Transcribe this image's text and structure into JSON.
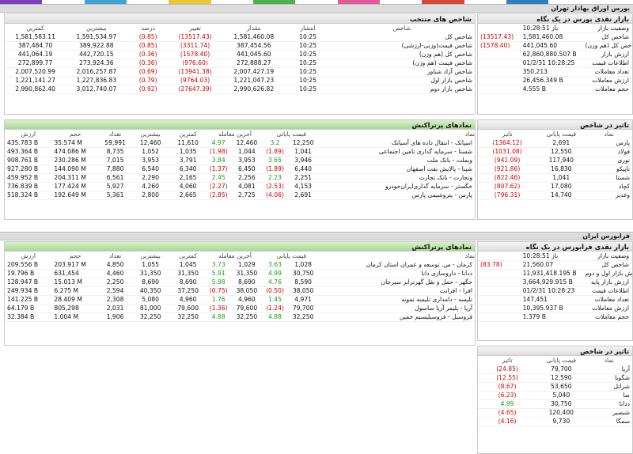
{
  "tse": {
    "title": "بورس اوراق بهادار تهران",
    "snapshot": {
      "title": "بازار نقدی بورس در یک نگاه",
      "rows": [
        {
          "label": "وضعیت بازار",
          "value": "باز 10:28:51",
          "extra": ""
        },
        {
          "label": "شاخص کل",
          "value": "1,581,460.08",
          "extra": "(13517.43)"
        },
        {
          "label": "شاخص کل (هم وزن)",
          "value": "441,045.60",
          "extra": "(1578.40)"
        },
        {
          "label": "ارزش بازار",
          "value": "62,860,880.507 B",
          "extra": ""
        },
        {
          "label": "اطلاعات قیمت",
          "value": "01/2/31 10:28:25",
          "extra": ""
        },
        {
          "label": "تعداد معاملات",
          "value": "350,213",
          "extra": ""
        },
        {
          "label": "ارزش معاملات",
          "value": "26,456.349 B",
          "extra": ""
        },
        {
          "label": "حجم معاملات",
          "value": "4.555 B",
          "extra": ""
        }
      ]
    },
    "indices": {
      "title": "شاخص های منتخب",
      "headers": [
        "شاخص",
        "انتشار",
        "مقدار",
        "تغییر",
        "درصد",
        "بیشترین",
        "کمترین"
      ],
      "rows": [
        {
          "name": "شاخص کل",
          "time": "10:25",
          "value": "1,581,460.08",
          "change": "(13517.43)",
          "pct": "(0.85)",
          "high": "1,591,534.97",
          "low": "1,581,583.11"
        },
        {
          "name": "شاخص قیمت(وزنی-ارزشی)",
          "time": "10:25",
          "value": "387,454.56",
          "change": "(3311.74)",
          "pct": "(0.85)",
          "high": "389,922.88",
          "low": "387,484.70"
        },
        {
          "name": "شاخص کل (هم وزن)",
          "time": "10:25",
          "value": "441,045.60",
          "change": "(1578.40)",
          "pct": "(0.36)",
          "high": "442,720.15",
          "low": "441,064.19"
        },
        {
          "name": "شاخص قیمت (هم وزن)",
          "time": "10:25",
          "value": "272,888.27",
          "change": "(976.60)",
          "pct": "(0.36)",
          "high": "273,924.36",
          "low": "272,899.77"
        },
        {
          "name": "شاخص آزاد شناور",
          "time": "10:25",
          "value": "2,007,427.19",
          "change": "(13941.38)",
          "pct": "(0.69)",
          "high": "2,016,257.87",
          "low": "2,007,520.99"
        },
        {
          "name": "شاخص بازار اول",
          "time": "10:25",
          "value": "1,221,047.23",
          "change": "(9764.03)",
          "pct": "(0.79)",
          "high": "1,227,836.83",
          "low": "1,221,141.27"
        },
        {
          "name": "شاخص بازار دوم",
          "time": "10:25",
          "value": "2,990,626.82",
          "change": "(27647.39)",
          "pct": "(0.92)",
          "high": "3,012,740.07",
          "low": "2,990,862.40"
        }
      ]
    },
    "impact": {
      "title": "تاثیر در شاخص",
      "headers": [
        "نماد",
        "قیمت پایانی",
        "تاثیر"
      ],
      "rows": [
        {
          "sym": "پارس",
          "price": "2,691",
          "effect": "(1364.12)"
        },
        {
          "sym": "فولاد",
          "price": "12,550",
          "effect": "(1031.08)"
        },
        {
          "sym": "نوری",
          "price": "117,940",
          "effect": "(941.09)"
        },
        {
          "sym": "تاپیکو",
          "price": "16,830",
          "effect": "(921.86)"
        },
        {
          "sym": "شستا",
          "price": "1,041",
          "effect": "(822.46)"
        },
        {
          "sym": "کچاد",
          "price": "17,080",
          "effect": "(807.62)"
        },
        {
          "sym": "وغدیر",
          "price": "14,740",
          "effect": "(796.31)"
        }
      ]
    },
    "top": {
      "title": "نمادهای پرتراکنش",
      "headers": [
        "نماد",
        "قیمت پایانی",
        "آخرین معامله",
        "کمترین",
        "بیشترین",
        "تعداد",
        "حجم",
        "ارزش"
      ],
      "rows": [
        {
          "name": "اسپانک - انتقال داده های آسیاتک",
          "close": "12,250",
          "close_chg": "3.2",
          "last": "12,460",
          "last_chg": "4.97",
          "low": "11,610",
          "high": "12,460",
          "count": "59,991",
          "vol": "35.574 M",
          "val": "435.783 B"
        },
        {
          "name": "شستا - سرمایه گذاری تامین اجتماعی",
          "close": "1,041",
          "close_chg": "(1.89)",
          "last": "1,044",
          "last_chg": "(1.98)",
          "low": "1,035",
          "high": "1,052",
          "count": "8,735",
          "vol": "474.086 M",
          "val": "493.364 B"
        },
        {
          "name": "وبملت - بانک ملت",
          "close": "3,946",
          "close_chg": "3.65",
          "last": "3,953",
          "last_chg": "3.84",
          "low": "3,791",
          "high": "3,953",
          "count": "7,015",
          "vol": "230.286 M",
          "val": "908.761 B"
        },
        {
          "name": "شپنا - پالایش نفت اصفهان",
          "close": "6,440",
          "close_chg": "(1.89)",
          "last": "6,450",
          "last_chg": "(1.37)",
          "low": "6,340",
          "high": "6,540",
          "count": "7,880",
          "vol": "144.090 M",
          "val": "927.280 B"
        },
        {
          "name": "وتجارت - بانک تجارت",
          "close": "2,251",
          "close_chg": "2.23",
          "last": "2,256",
          "last_chg": "2.45",
          "low": "2,165",
          "high": "2,290",
          "count": "6,561",
          "vol": "204.311 M",
          "val": "459.952 B"
        },
        {
          "name": "خگستر - سرمایه گذاری‌ایران‌خودرو",
          "close": "4,153",
          "close_chg": "(2.53)",
          "last": "4,081",
          "last_chg": "(2.27)",
          "low": "4,060",
          "high": "4,260",
          "count": "5,927",
          "vol": "177.424 M",
          "val": "736.839 B"
        },
        {
          "name": "پارس - پتروشیمی پارس",
          "close": "2,691",
          "close_chg": "(4.06)",
          "last": "2,725",
          "last_chg": "(2.85)",
          "low": "2,665",
          "high": "2,800",
          "count": "5,361",
          "vol": "192.649 M",
          "val": "518.324 B"
        }
      ]
    }
  },
  "ifb": {
    "title": "فرابورس ایران",
    "snapshot": {
      "title": "بازار نقدی فرابورس در یک نگاه",
      "rows": [
        {
          "label": "وضعیت بازار",
          "value": "باز 10:28:51",
          "extra": ""
        },
        {
          "label": "شاخص کل",
          "value": "21,560.07",
          "extra": "(83.78)"
        },
        {
          "label": "ارزش بازار اول و دوم",
          "value": "11,931,418.195 B",
          "extra": ""
        },
        {
          "label": "ارزش بازار پایه",
          "value": "3,664,929.915 B",
          "extra": ""
        },
        {
          "label": "اطلاعات قیمت",
          "value": "01/2/31 10:28:23",
          "extra": ""
        },
        {
          "label": "تعداد معاملات",
          "value": "147,451",
          "extra": ""
        },
        {
          "label": "ارزش معاملات",
          "value": "10,395.937 B",
          "extra": ""
        },
        {
          "label": "حجم معاملات",
          "value": "1.379 B",
          "extra": ""
        }
      ]
    },
    "impact": {
      "title": "تاثیر در شاخص",
      "headers": [
        "نماد",
        "قیمت پایانی",
        "تاثیر"
      ],
      "rows": [
        {
          "sym": "آریا",
          "price": "79,700",
          "effect": "(24.85)"
        },
        {
          "sym": "شگویا",
          "price": "12,590",
          "effect": "(12.55)"
        },
        {
          "sym": "شراتل",
          "price": "53,650",
          "effect": "(8.67)"
        },
        {
          "sym": "ضا",
          "price": "5,040",
          "effect": "(6.23)"
        },
        {
          "sym": "ددانا",
          "price": "30,750",
          "effect": "4.99"
        },
        {
          "sym": "شبصیر",
          "price": "120,400",
          "effect": "(4.65)"
        },
        {
          "sym": "سمگا",
          "price": "9,730",
          "effect": "(4.16)"
        }
      ]
    },
    "top": {
      "title": "نمادهای پرتراکنش",
      "headers": [
        "نماد",
        "قیمت پایانی",
        "آخرین معامله",
        "کمترین",
        "بیشترین",
        "تعداد",
        "حجم",
        "ارزش"
      ],
      "rows": [
        {
          "name": "کرمان - س. توسعه و عمران استان کرمان",
          "close": "1,028",
          "close_chg": "3.63",
          "last": "1,029",
          "last_chg": "3.73",
          "low": "1,045",
          "high": "1,055",
          "count": "4,850",
          "vol": "203.917 M",
          "val": "209.556 B"
        },
        {
          "name": "ددانا - داروسازی دانا",
          "close": "30,750",
          "close_chg": "4.99",
          "last": "31,350",
          "last_chg": "5.91",
          "low": "31,350",
          "high": "31,350",
          "count": "4,460",
          "vol": "631,454",
          "val": "19.796 B"
        },
        {
          "name": "حگهر - حمل و نقل گهرترابر سیرجان",
          "close": "8,590",
          "close_chg": "4.76",
          "last": "8,690",
          "last_chg": "5.98",
          "low": "8,690",
          "high": "8,690",
          "count": "2,250",
          "vol": "15.013 M",
          "val": "128.947 B"
        },
        {
          "name": "افرا - افرانت",
          "close": "38,050",
          "close_chg": "(0.50)",
          "last": "38,050",
          "last_chg": "(0.75)",
          "low": "37,250",
          "high": "40,350",
          "count": "2,594",
          "vol": "6.275 M",
          "val": "249.934 B"
        },
        {
          "name": "تلیسه - دامداری تلیسه نمونه",
          "close": "4,971",
          "close_chg": "1.45",
          "last": "4,960",
          "last_chg": "1.76",
          "low": "4,960",
          "high": "5,080",
          "count": "2,308",
          "vol": "28.409 M",
          "val": "141.225 B"
        },
        {
          "name": "آریا - پلیمر آریا ساسول",
          "close": "79,700",
          "close_chg": "(1.24)",
          "last": "79,600",
          "last_chg": "(1.36)",
          "low": "79,600",
          "high": "81,000",
          "count": "2,031",
          "vol": "805,298",
          "val": "64.179 B"
        },
        {
          "name": "فروسیل - فروسیلیسیم خمین",
          "close": "32,250",
          "close_chg": "4.88",
          "last": "32,250",
          "last_chg": "4.88",
          "low": "32,250",
          "high": "32,250",
          "count": "1,906",
          "vol": "1.004 M",
          "val": "32.384 B"
        }
      ]
    }
  }
}
